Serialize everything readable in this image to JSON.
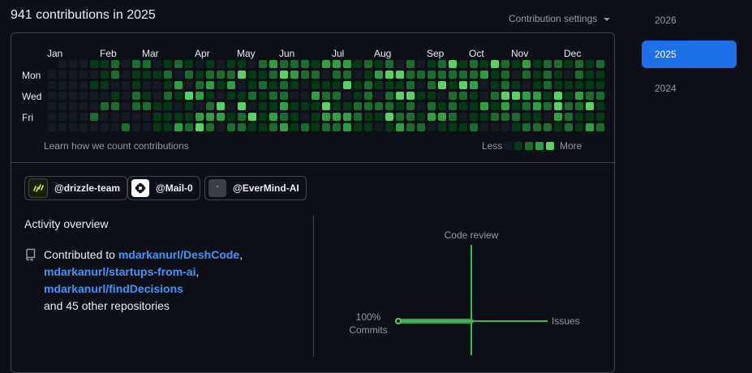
{
  "header": {
    "title": "941 contributions in 2025",
    "settings_label": "Contribution settings"
  },
  "calendar": {
    "months": [
      "Jan",
      "Feb",
      "Mar",
      "Apr",
      "May",
      "Jun",
      "Jul",
      "Aug",
      "Sep",
      "Oct",
      "Nov",
      "Dec"
    ],
    "days": [
      "Mon",
      "Wed",
      "Fri"
    ],
    "learn_link": "Learn how we count contributions",
    "legend_less": "Less",
    "legend_more": "More",
    "colors": [
      "#151b23",
      "#033a16",
      "#196c2e",
      "#2ea043",
      "#56d364"
    ]
  },
  "organizations": [
    {
      "label": "@drizzle-team",
      "logo": "drizzle-logo"
    },
    {
      "label": "@Mail-0",
      "logo": "mail0-logo"
    },
    {
      "label": "@EverMind-AI",
      "logo": "evermind-logo"
    }
  ],
  "activity": {
    "title": "Activity overview",
    "prefix": "Contributed to",
    "repos": [
      "mdarkanurl/DeshCode",
      "mdarkanurl/startups-from-ai",
      "mdarkanurl/findDecisions"
    ],
    "suffix": "and 45 other repositories",
    "chart": {
      "top_label": "Code review",
      "right_label": "Issues",
      "left_percent": "100%",
      "left_label": "Commits",
      "commits_percent": 100,
      "accent": "#3fb950"
    }
  },
  "years": [
    {
      "label": "2026",
      "active": false
    },
    {
      "label": "2025",
      "active": true
    },
    {
      "label": "2024",
      "active": false
    }
  ]
}
